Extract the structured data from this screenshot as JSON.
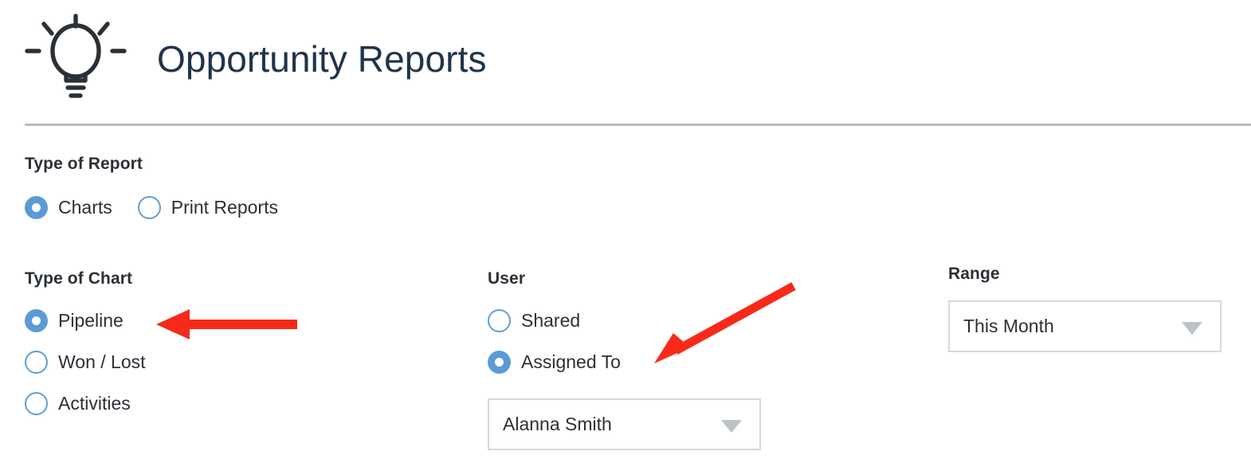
{
  "header": {
    "title": "Opportunity Reports",
    "icon": "lightbulb-icon",
    "title_color": "#20344a",
    "icon_color": "#2b3036",
    "divider_color": "#b4bcc4"
  },
  "theme": {
    "accent_blue": "#5b9bd5",
    "radio_outline_blue": "#5e9fd6",
    "text_dark": "#2b3036",
    "border_gray": "#d4d9de",
    "chevron_gray": "#bcc2c8",
    "annotation_red": "#f72a1a"
  },
  "type_of_report": {
    "heading": "Type of Report",
    "options": [
      {
        "label": "Charts",
        "selected": true
      },
      {
        "label": "Print Reports",
        "selected": false
      }
    ]
  },
  "type_of_chart": {
    "heading": "Type of Chart",
    "options": [
      {
        "label": "Pipeline",
        "selected": true
      },
      {
        "label": "Won / Lost",
        "selected": false
      },
      {
        "label": "Activities",
        "selected": false
      }
    ]
  },
  "user": {
    "heading": "User",
    "options": [
      {
        "label": "Shared",
        "selected": false
      },
      {
        "label": "Assigned To",
        "selected": true
      }
    ],
    "dropdown": {
      "value": "Alanna Smith",
      "chevron": "chevron-down-icon"
    }
  },
  "range": {
    "heading": "Range",
    "dropdown": {
      "value": "This Month",
      "chevron": "chevron-down-icon"
    }
  },
  "annotations": [
    {
      "name": "arrow-to-pipeline",
      "shape": "straight-left-arrow",
      "color": "#f72a1a"
    },
    {
      "name": "arrow-to-assigned-to",
      "shape": "diagonal-down-left-arrow",
      "color": "#f72a1a"
    }
  ]
}
